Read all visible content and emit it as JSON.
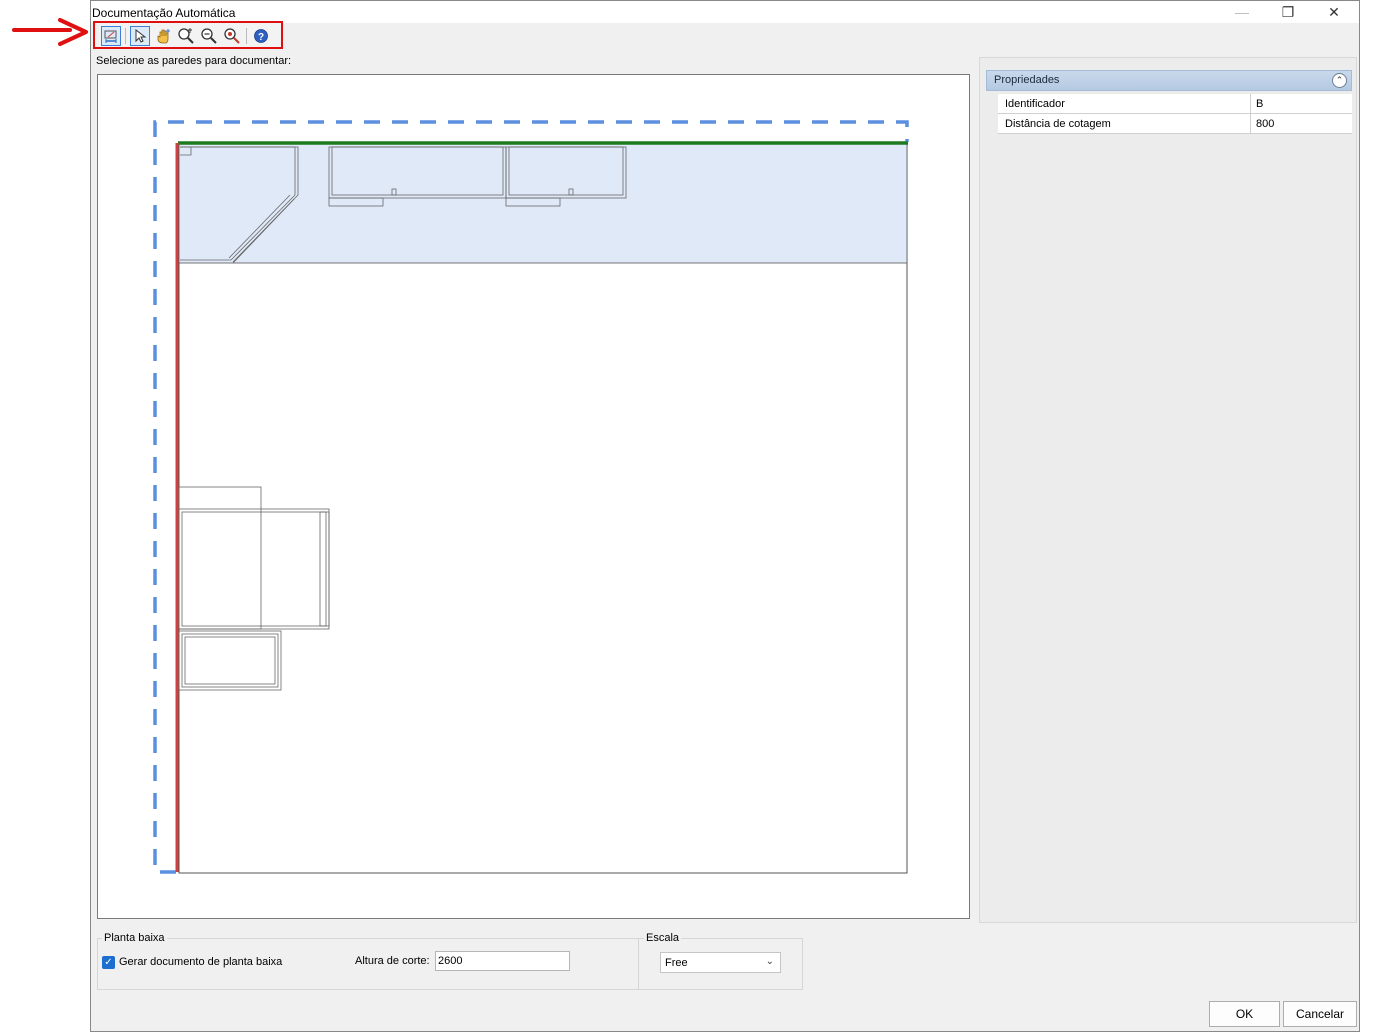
{
  "window": {
    "title": "Documentação Automática",
    "minimize_glyph": "—",
    "restore_glyph": "❐",
    "close_glyph": "✕"
  },
  "toolbar": {
    "buttons": [
      {
        "icon": "wall-dimension-icon"
      },
      {
        "icon": "pointer-select-icon"
      },
      {
        "icon": "pan-hand-icon"
      },
      {
        "icon": "zoom-extents-icon"
      },
      {
        "icon": "zoom-in-icon"
      },
      {
        "icon": "zoom-out-icon"
      },
      {
        "icon": "help-icon"
      }
    ],
    "highlight_color": "#e01010"
  },
  "prompt": "Selecione as paredes para documentar:",
  "properties": {
    "header": "Propriedades",
    "rows": [
      {
        "name": "Identificador",
        "value": "B"
      },
      {
        "name": "Distância de cotagem",
        "value": "800"
      }
    ]
  },
  "floor_plan_group": {
    "label": "Planta baixa",
    "checkbox_label": "Gerar documento de planta baixa",
    "checked": true,
    "cut_height_label": "Altura de corte:",
    "cut_height_value": "2600"
  },
  "scale_group": {
    "label": "Escala",
    "selected": "Free"
  },
  "buttons": {
    "ok": "OK",
    "cancel": "Cancelar"
  },
  "colors": {
    "selected_wall_top": "#1e7a1e",
    "selected_wall_left": "#d04040",
    "dashed_selection": "#5b8fe0",
    "highlight_fill": "#e0e9f8",
    "annotation_arrow": "#e01010"
  }
}
